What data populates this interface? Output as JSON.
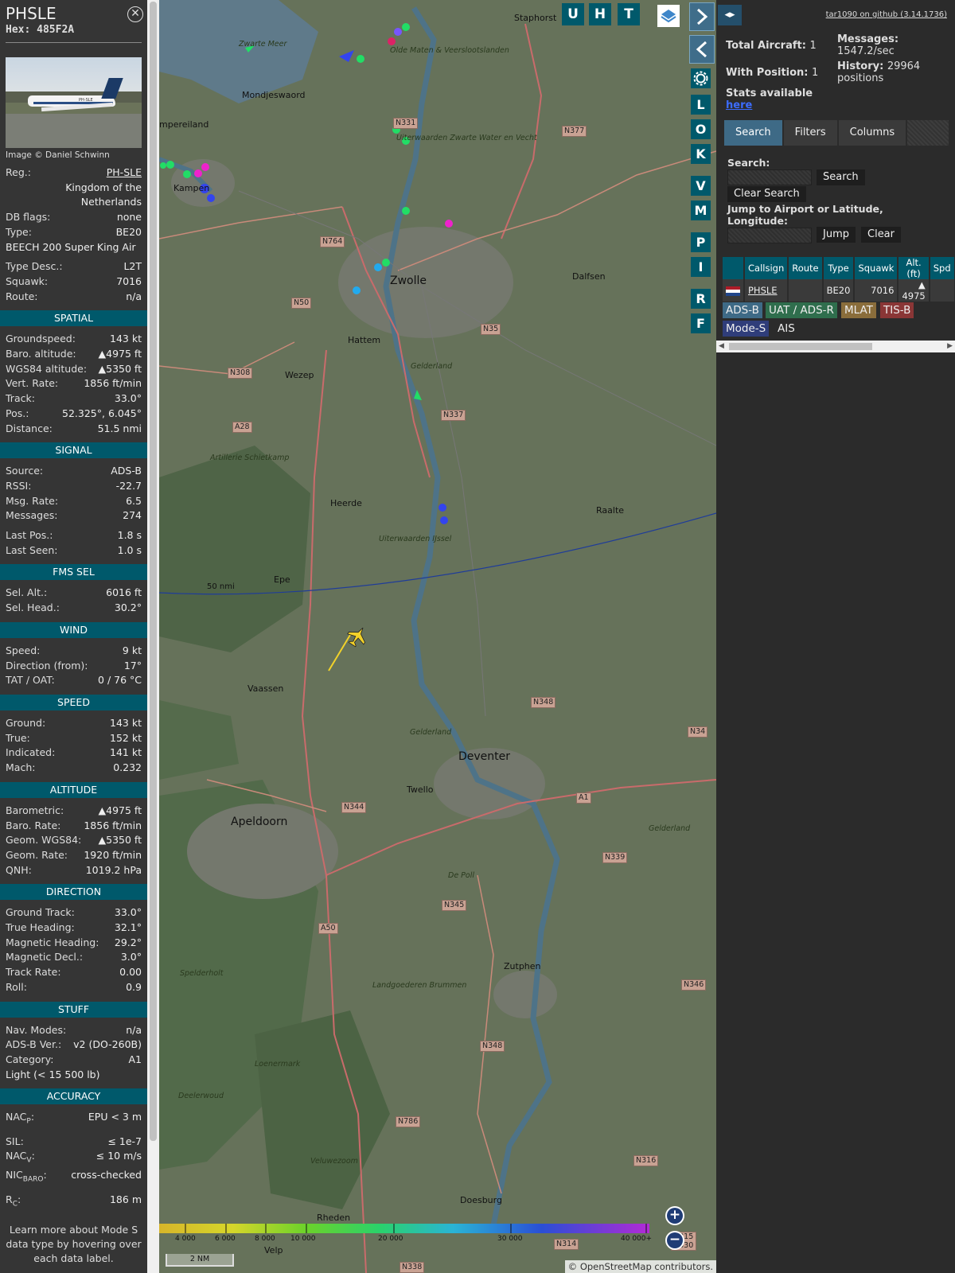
{
  "info": {
    "callsign": "PHSLE",
    "hex": "Hex: 485F2A",
    "photo_credit": "Image © Daniel Schwinn",
    "photo_reg_text": "PH-SLE",
    "details": [
      {
        "label": "Reg.:",
        "value": "PH-SLE",
        "link": true
      },
      {
        "label": "",
        "value": "Kingdom of the Netherlands"
      },
      {
        "label": "DB flags:",
        "value": "none"
      },
      {
        "label": "Type:",
        "value": "BE20"
      },
      {
        "label": "",
        "value": "BEECH 200 Super King Air",
        "left": true
      },
      {
        "gap": true
      },
      {
        "label": "Type Desc.:",
        "value": "L2T"
      },
      {
        "label": "Squawk:",
        "value": "7016"
      },
      {
        "label": "Route:",
        "value": "n/a"
      }
    ],
    "sections": [
      {
        "title": "SPATIAL",
        "rows": [
          {
            "label": "Groundspeed:",
            "value": "143 kt"
          },
          {
            "label": "Baro. altitude:",
            "value": "▲4975 ft"
          },
          {
            "label": "WGS84 altitude:",
            "value": "▲5350 ft"
          },
          {
            "label": "Vert. Rate:",
            "value": "1856 ft/min"
          },
          {
            "label": "Track:",
            "value": "33.0°"
          },
          {
            "label": "Pos.:",
            "value": "52.325°, 6.045°"
          },
          {
            "label": "Distance:",
            "value": "51.5 nmi"
          }
        ]
      },
      {
        "title": "SIGNAL",
        "rows": [
          {
            "label": "Source:",
            "value": "ADS-B"
          },
          {
            "label": "RSSI:",
            "value": "-22.7"
          },
          {
            "label": "Msg. Rate:",
            "value": "6.5"
          },
          {
            "label": "Messages:",
            "value": "274"
          },
          {
            "gap": true
          },
          {
            "label": "Last Pos.:",
            "value": "1.8 s"
          },
          {
            "label": "Last Seen:",
            "value": "1.0 s"
          }
        ]
      },
      {
        "title": "FMS SEL",
        "rows": [
          {
            "label": "Sel. Alt.:",
            "value": "6016 ft"
          },
          {
            "label": "Sel. Head.:",
            "value": "30.2°"
          }
        ]
      },
      {
        "title": "WIND",
        "rows": [
          {
            "label": "Speed:",
            "value": "9 kt"
          },
          {
            "label": "Direction (from):",
            "value": "17°"
          },
          {
            "label": "TAT / OAT:",
            "value": "0 / 76 °C"
          }
        ]
      },
      {
        "title": "SPEED",
        "rows": [
          {
            "label": "Ground:",
            "value": "143 kt"
          },
          {
            "label": "True:",
            "value": "152 kt"
          },
          {
            "label": "Indicated:",
            "value": "141 kt"
          },
          {
            "label": "Mach:",
            "value": "0.232"
          }
        ]
      },
      {
        "title": "ALTITUDE",
        "rows": [
          {
            "label": "Barometric:",
            "value": "▲4975 ft"
          },
          {
            "label": "Baro. Rate:",
            "value": "1856 ft/min"
          },
          {
            "label": "Geom. WGS84:",
            "value": "▲5350 ft"
          },
          {
            "label": "Geom. Rate:",
            "value": "1920 ft/min"
          },
          {
            "label": "QNH:",
            "value": "1019.2 hPa"
          }
        ]
      },
      {
        "title": "DIRECTION",
        "rows": [
          {
            "label": "Ground Track:",
            "value": "33.0°"
          },
          {
            "label": "True Heading:",
            "value": "32.1°"
          },
          {
            "label": "Magnetic Heading:",
            "value": "29.2°"
          },
          {
            "label": "Magnetic Decl.:",
            "value": "3.0°"
          },
          {
            "label": "Track Rate:",
            "value": "0.00"
          },
          {
            "label": "Roll:",
            "value": "0.9"
          }
        ]
      },
      {
        "title": "STUFF",
        "rows": [
          {
            "label": "Nav. Modes:",
            "value": "n/a"
          },
          {
            "label": "ADS-B Ver.:",
            "value": "v2 (DO-260B)"
          },
          {
            "label": "Category:",
            "value": "A1"
          },
          {
            "label": "",
            "value": "Light (< 15 500 lb)",
            "left": true
          }
        ]
      }
    ],
    "accuracy_title": "ACCURACY",
    "accuracy": {
      "nacp": {
        "label": "NAC",
        "sub": "P",
        "value": "EPU < 3 m"
      },
      "sil": {
        "label": "SIL:",
        "value": "≤ 1e-7"
      },
      "nacv": {
        "label": "NAC",
        "sub": "V",
        "value": "≤ 10 m/s"
      },
      "nicbaro": {
        "label": "NIC",
        "sub": "BARO",
        "value": "cross-checked"
      },
      "rc": {
        "label": "R",
        "sub": "C",
        "value": "186 m"
      }
    },
    "footer": "Learn more about Mode S data type by hovering over each data label."
  },
  "map": {
    "buttons": {
      "u": "U",
      "h": "H",
      "t": "T",
      "l": "L",
      "o": "O",
      "k": "K",
      "v": "V",
      "m": "M",
      "p": "P",
      "i": "I",
      "r": "R",
      "f": "F"
    },
    "zoom_in": "+",
    "zoom_out": "−",
    "range_ring_label": "50 nmi",
    "scale_bar": "2 NM",
    "attribution": "© OpenStreetMap contributors.",
    "altitude_ticks": [
      "4 000",
      "6 000",
      "8 000",
      "10 000",
      "20 000",
      "30 000",
      "40 000+"
    ],
    "places": [
      {
        "name": "Zwolle",
        "cls": "big"
      },
      {
        "name": "Deventer",
        "cls": "big"
      },
      {
        "name": "Apeldoorn",
        "cls": "big"
      },
      {
        "name": "Kampen"
      },
      {
        "name": "Hattem"
      },
      {
        "name": "Wezep"
      },
      {
        "name": "Heerde"
      },
      {
        "name": "Epe"
      },
      {
        "name": "Vaassen"
      },
      {
        "name": "Twello"
      },
      {
        "name": "Zutphen"
      },
      {
        "name": "Raalte"
      },
      {
        "name": "Dalfsen"
      },
      {
        "name": "Staphorst"
      },
      {
        "name": "Mondjeswaord"
      },
      {
        "name": "Rheden"
      },
      {
        "name": "Velp"
      },
      {
        "name": "Doesburg"
      },
      {
        "name": "mpereiland"
      }
    ],
    "areas": [
      "Zwarte Meer",
      "Olde Maten & Veerslootslanden",
      "Uiterwaarden Zwarte Water en Vecht",
      "Artillerie Schietkamp",
      "Uiterwaarden IJssel",
      "Landgoederen Brummen",
      "Loenermark",
      "Veluwezoom",
      "Deelerwoud",
      "Spelderholt",
      "De Poll",
      "Gelderland",
      "Gelderland",
      "Gelderland"
    ],
    "roads": [
      "N331",
      "N377",
      "N764",
      "N50",
      "N35",
      "N308",
      "A28",
      "N337",
      "N348",
      "N344",
      "A1",
      "N339",
      "N345",
      "A50",
      "N348",
      "N786",
      "N316",
      "N314",
      "N338",
      "N315 N330",
      "N34",
      "N346"
    ]
  },
  "side": {
    "toggle": "◂▸",
    "github": "tar1090 on github (3.14.1736)",
    "total_aircraft_label": "Total Aircraft:",
    "total_aircraft": "1",
    "with_position_label": "With Position:",
    "with_position": "1",
    "messages_label": "Messages:",
    "messages": "1547.2/sec",
    "history_label": "History:",
    "history": "29964 positions",
    "stats_text": "Stats available",
    "stats_link": "here",
    "tabs": [
      "Search",
      "Filters",
      "Columns"
    ],
    "search_label": "Search:",
    "search_button": "Search",
    "clear_search_button": "Clear Search",
    "jump_label": "Jump to Airport or Latitude, Longitude:",
    "jump_button": "Jump",
    "clear_button": "Clear",
    "table_headers": [
      "",
      "Callsign",
      "Route",
      "Type",
      "Squawk",
      "Alt. (ft)",
      "Spd"
    ],
    "table_rows": [
      {
        "callsign": "PHSLE",
        "route": "",
        "type": "BE20",
        "squawk": "7016",
        "alt": "▲ 4975",
        "spd": ""
      }
    ],
    "sources": [
      {
        "label": "ADS-B",
        "color": "#3e6a86"
      },
      {
        "label": "UAT / ADS-R",
        "color": "#2f6e4d"
      },
      {
        "label": "MLAT",
        "color": "#8a6d3b"
      },
      {
        "label": "TIS-B",
        "color": "#8a3636"
      },
      {
        "label": "Mode-S",
        "color": "#2f3d7a"
      },
      {
        "label": "AIS",
        "color": "transparent"
      }
    ]
  }
}
